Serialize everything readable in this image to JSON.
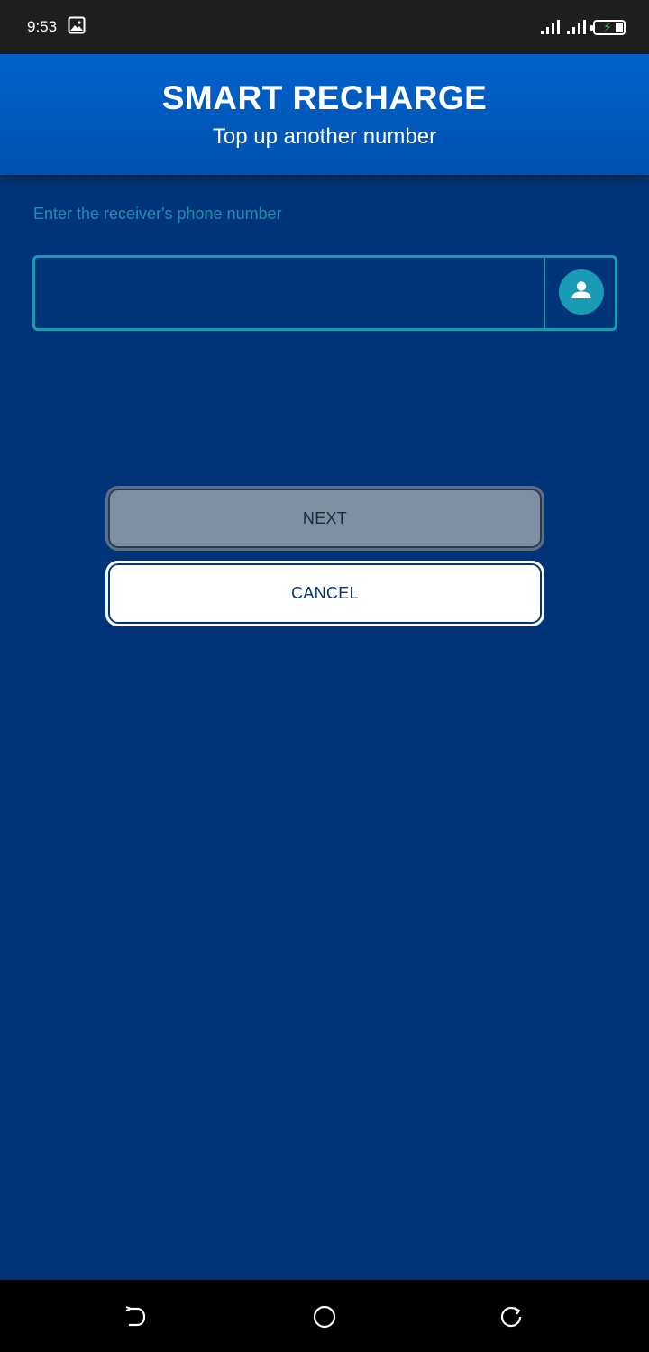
{
  "status_bar": {
    "time": "9:53",
    "icons": [
      "image-icon",
      "signal-icon",
      "signal-icon",
      "battery-charging-icon"
    ]
  },
  "header": {
    "title": "SMART RECHARGE",
    "subtitle": "Top up another number"
  },
  "form": {
    "label": "Enter the receiver's phone number",
    "phone_value": "",
    "phone_placeholder": "",
    "contact_icon": "contact-person-icon"
  },
  "buttons": {
    "next_label": "NEXT",
    "cancel_label": "CANCEL"
  },
  "nav": {
    "items": [
      "back-icon",
      "home-icon",
      "recents-icon"
    ]
  },
  "colors": {
    "background": "#003478",
    "header": "#0063cc",
    "accent": "#1a9bb5",
    "next_disabled": "#8090a3"
  }
}
